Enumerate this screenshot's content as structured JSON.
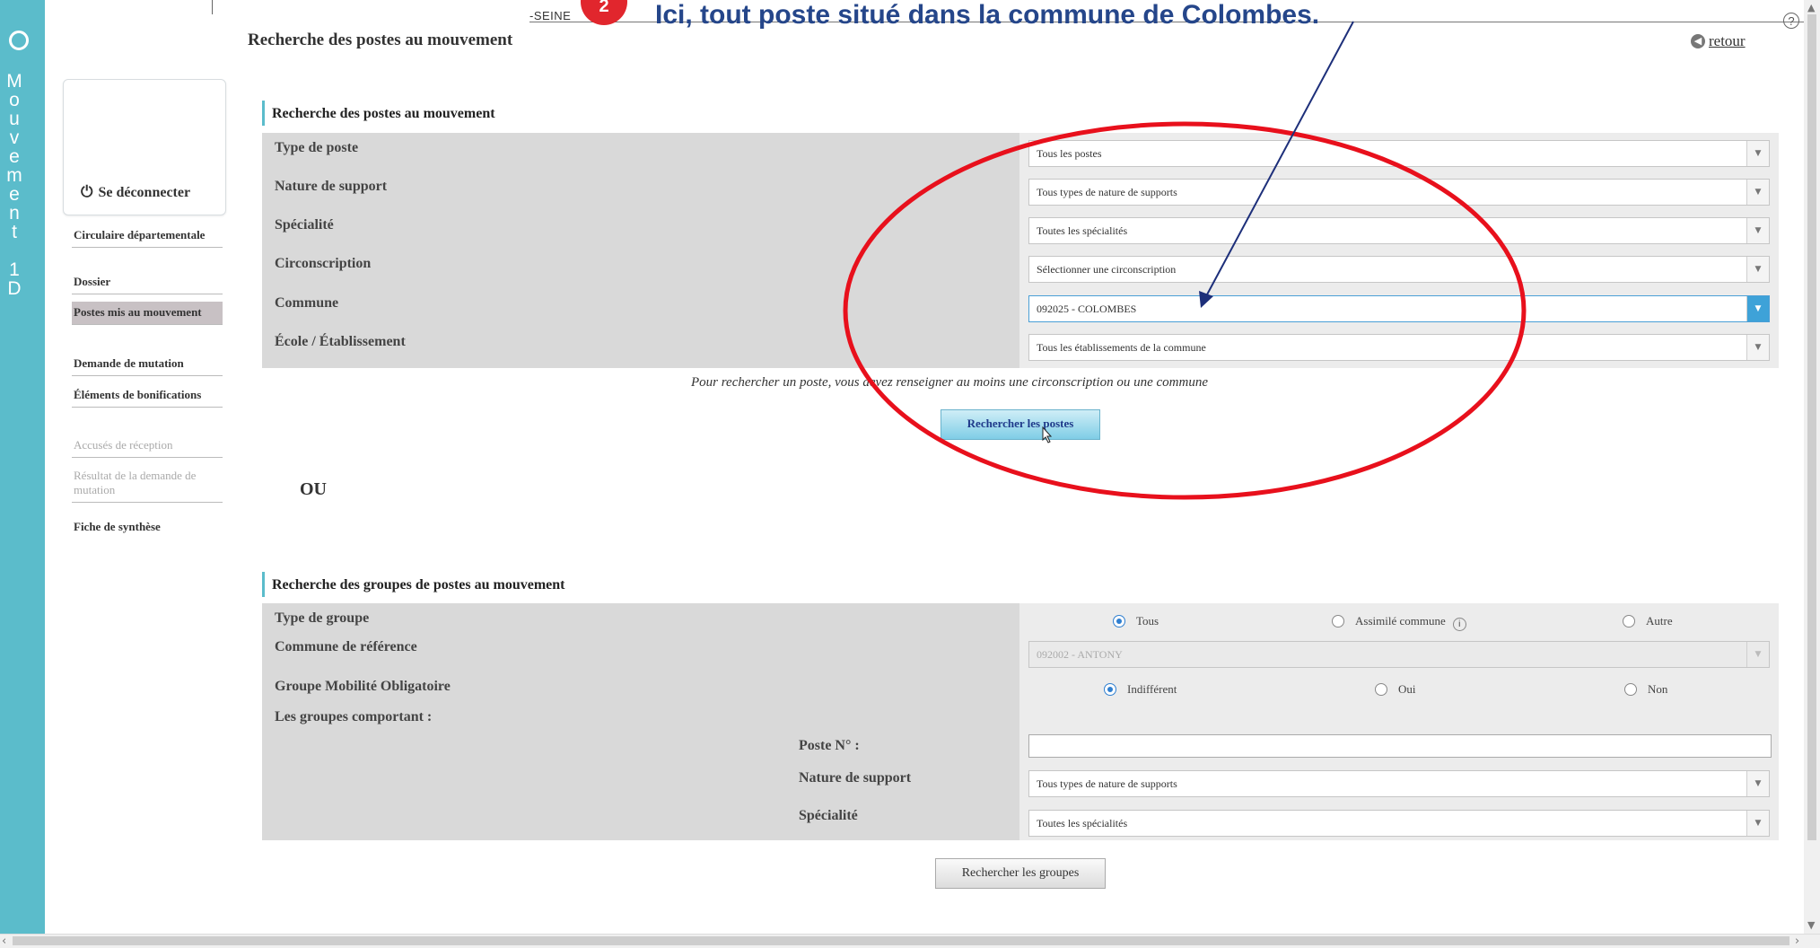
{
  "app": {
    "brand_letters": [
      "M",
      "o",
      "u",
      "v",
      "e",
      "m",
      "e",
      "n",
      "t",
      "",
      "1",
      "D"
    ],
    "academy_fragment": "-SEINE",
    "page_heading": "Recherche des postes au mouvement",
    "back_label": "retour",
    "help_label": "?"
  },
  "annotation": {
    "step_number": "2",
    "text": "Ici, tout poste situé dans la commune de Colombes."
  },
  "sidebar": {
    "logout_label": "Se déconnecter",
    "items": [
      {
        "label": "Circulaire départementale",
        "state": "normal"
      },
      {
        "label": "Dossier",
        "state": "normal"
      },
      {
        "label": "Postes mis au mouvement",
        "state": "active"
      },
      {
        "label": "Demande de mutation",
        "state": "normal"
      },
      {
        "label": "Éléments de bonifications",
        "state": "normal"
      },
      {
        "label": "Accusés de réception",
        "state": "disabled"
      },
      {
        "label": "Résultat de la demande de mutation",
        "state": "disabled"
      },
      {
        "label": "Fiche de synthèse",
        "state": "normal"
      }
    ]
  },
  "postes_search": {
    "title": "Recherche des postes au mouvement",
    "fields": [
      {
        "label": "Type de poste",
        "value": "Tous les postes"
      },
      {
        "label": "Nature de support",
        "value": "Tous types de nature de supports"
      },
      {
        "label": "Spécialité",
        "value": "Toutes les spécialités"
      },
      {
        "label": "Circonscription",
        "value": "Sélectionner une circonscription"
      },
      {
        "label": "Commune",
        "value": "092025 - COLOMBES"
      },
      {
        "label": "École / Établissement",
        "value": "Tous les établissements de la commune"
      }
    ],
    "hint": "Pour rechercher un poste, vous devez renseigner au moins une circonscription ou une commune",
    "search_button": "Rechercher les postes"
  },
  "or_label": "OU",
  "groupes_search": {
    "title": "Recherche des groupes de postes au mouvement",
    "type_groupe_label": "Type de groupe",
    "type_groupe_options": [
      {
        "label": "Tous",
        "checked": true
      },
      {
        "label": "Assimilé commune",
        "checked": false
      },
      {
        "label": "Autre",
        "checked": false
      }
    ],
    "info_icon": "i",
    "commune_ref_label": "Commune de référence",
    "commune_ref_value": "092002 - ANTONY",
    "mobilite_label": "Groupe Mobilité Obligatoire",
    "mobilite_options": [
      {
        "label": "Indifférent",
        "checked": true
      },
      {
        "label": "Oui",
        "checked": false
      },
      {
        "label": "Non",
        "checked": false
      }
    ],
    "comportant_label": "Les groupes comportant :",
    "poste_no_label": "Poste N° :",
    "poste_no_value": "",
    "nature_label": "Nature de support",
    "nature_value": "Tous types de nature de supports",
    "specialite_label": "Spécialité",
    "specialite_value": "Toutes les spécialités",
    "search_button": "Rechercher les groupes"
  },
  "colors": {
    "brand": "#5bbccb",
    "annotation_red": "#e1262d",
    "annotation_text": "#25468a",
    "active_item": "#c8c1c4"
  }
}
